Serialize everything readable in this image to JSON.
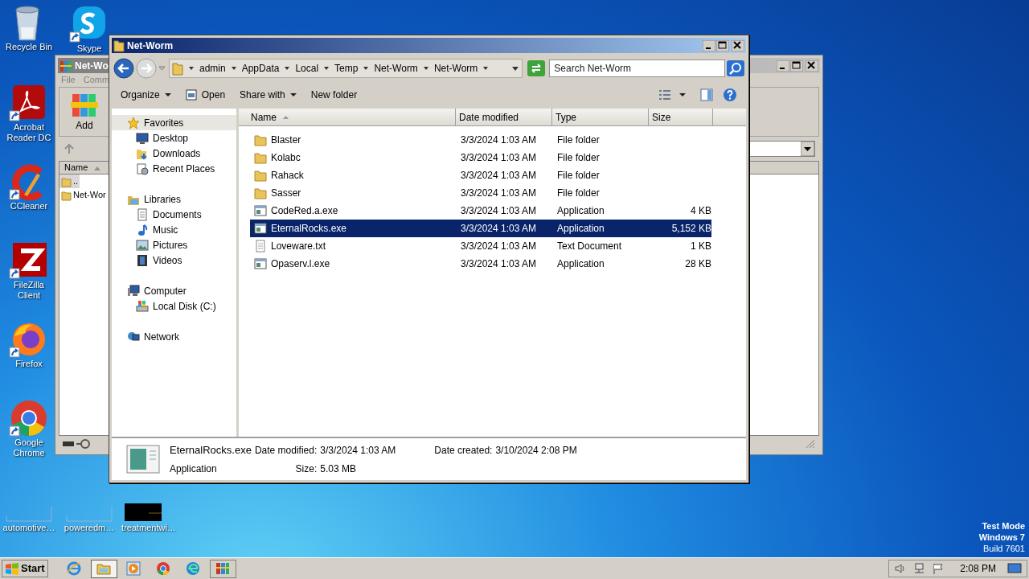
{
  "desktop_icons": [
    {
      "label": "Recycle Bin",
      "kind": "recycle"
    },
    {
      "label": "Skype",
      "kind": "skype"
    },
    {
      "label": "Acrobat Reader DC",
      "kind": "acrobat"
    },
    {
      "label": "CCleaner",
      "kind": "ccleaner"
    },
    {
      "label": "FileZilla Client",
      "kind": "filezilla"
    },
    {
      "label": "Firefox",
      "kind": "firefox"
    },
    {
      "label": "Google Chrome",
      "kind": "chrome"
    },
    {
      "label": "automotive…",
      "kind": "blank"
    },
    {
      "label": "poweredm…",
      "kind": "blank"
    },
    {
      "label": "treatmentwi…",
      "kind": "dark"
    }
  ],
  "background_window": {
    "title": "Net-Wo",
    "menu": [
      "File",
      "Comm"
    ],
    "toolbar": [
      "Add"
    ],
    "list_header": "Name",
    "rows": [
      {
        "name": "..",
        "selected": true
      },
      {
        "name": "Net-Wor",
        "selected": false
      }
    ]
  },
  "explorer": {
    "title": "Net-Worm",
    "breadcrumb": [
      "admin",
      "AppData",
      "Local",
      "Temp",
      "Net-Worm",
      "Net-Worm"
    ],
    "search": {
      "placeholder": "Search Net-Worm"
    },
    "toolbar": [
      {
        "label": "Organize",
        "kind": "menu"
      },
      {
        "label": "Open",
        "kind": "open"
      },
      {
        "label": "Share with",
        "kind": "menu"
      },
      {
        "label": "New folder",
        "kind": "plain"
      }
    ],
    "nav": [
      {
        "label": "Favorites",
        "kind": "star",
        "selected": true,
        "children": [
          {
            "label": "Desktop",
            "kind": "desktop",
            "selected": false
          },
          {
            "label": "Downloads",
            "kind": "downloads",
            "selected": false
          },
          {
            "label": "Recent Places",
            "kind": "recent",
            "selected": false
          }
        ]
      },
      {
        "label": "Libraries",
        "kind": "libraries",
        "selected": false,
        "children": [
          {
            "label": "Documents",
            "kind": "documents",
            "selected": false
          },
          {
            "label": "Music",
            "kind": "music",
            "selected": false
          },
          {
            "label": "Pictures",
            "kind": "pictures",
            "selected": false
          },
          {
            "label": "Videos",
            "kind": "videos",
            "selected": false
          }
        ]
      },
      {
        "label": "Computer",
        "kind": "computer",
        "selected": false,
        "children": [
          {
            "label": "Local Disk (C:)",
            "kind": "disk",
            "selected": false
          }
        ]
      },
      {
        "label": "Network",
        "kind": "network",
        "selected": false
      }
    ],
    "columns": [
      {
        "label": "Name",
        "sorted": true
      },
      {
        "label": "Date modified",
        "sorted": false
      },
      {
        "label": "Type",
        "sorted": false
      },
      {
        "label": "Size",
        "sorted": false
      }
    ],
    "rows": [
      {
        "name": "Blaster",
        "date": "3/3/2024 1:03 AM",
        "type": "File folder",
        "kind": "folder",
        "selected": false
      },
      {
        "name": "Kolabc",
        "date": "3/3/2024 1:03 AM",
        "type": "File folder",
        "kind": "folder",
        "selected": false
      },
      {
        "name": "Rahack",
        "date": "3/3/2024 1:03 AM",
        "type": "File folder",
        "kind": "folder",
        "selected": false
      },
      {
        "name": "Sasser",
        "date": "3/3/2024 1:03 AM",
        "type": "File folder",
        "kind": "folder",
        "selected": false
      },
      {
        "name": "CodeRed.a.exe",
        "date": "3/3/2024 1:03 AM",
        "type": "Application",
        "size": "4 KB",
        "kind": "app",
        "selected": false
      },
      {
        "name": "EternalRocks.exe",
        "date": "3/3/2024 1:03 AM",
        "type": "Application",
        "size": "5,152 KB",
        "kind": "app",
        "selected": true
      },
      {
        "name": "Loveware.txt",
        "date": "3/3/2024 1:03 AM",
        "type": "Text Document",
        "size": "1 KB",
        "kind": "text",
        "selected": false
      },
      {
        "name": "Opaserv.l.exe",
        "date": "3/3/2024 1:03 AM",
        "type": "Application",
        "size": "28 KB",
        "kind": "app",
        "selected": false
      }
    ],
    "details": {
      "name": "EternalRocks.exe",
      "type": "Application",
      "modified_label": "Date modified:",
      "modified": "3/3/2024 1:03 AM",
      "created_label": "Date created:",
      "created": "3/10/2024 2:08 PM",
      "size_label": "Size:",
      "size": "5.03 MB"
    }
  },
  "taskbar": {
    "start": "Start",
    "apps": [
      {
        "kind": "ie",
        "active": false
      },
      {
        "kind": "explorer",
        "active": true
      },
      {
        "kind": "media",
        "active": false
      },
      {
        "kind": "chrome",
        "active": false
      },
      {
        "kind": "edge",
        "active": false
      },
      {
        "kind": "winrar",
        "active": false
      }
    ],
    "clock": "2:08 PM"
  },
  "system_text": [
    "Test Mode",
    "Windows 7",
    "Build 7601"
  ]
}
